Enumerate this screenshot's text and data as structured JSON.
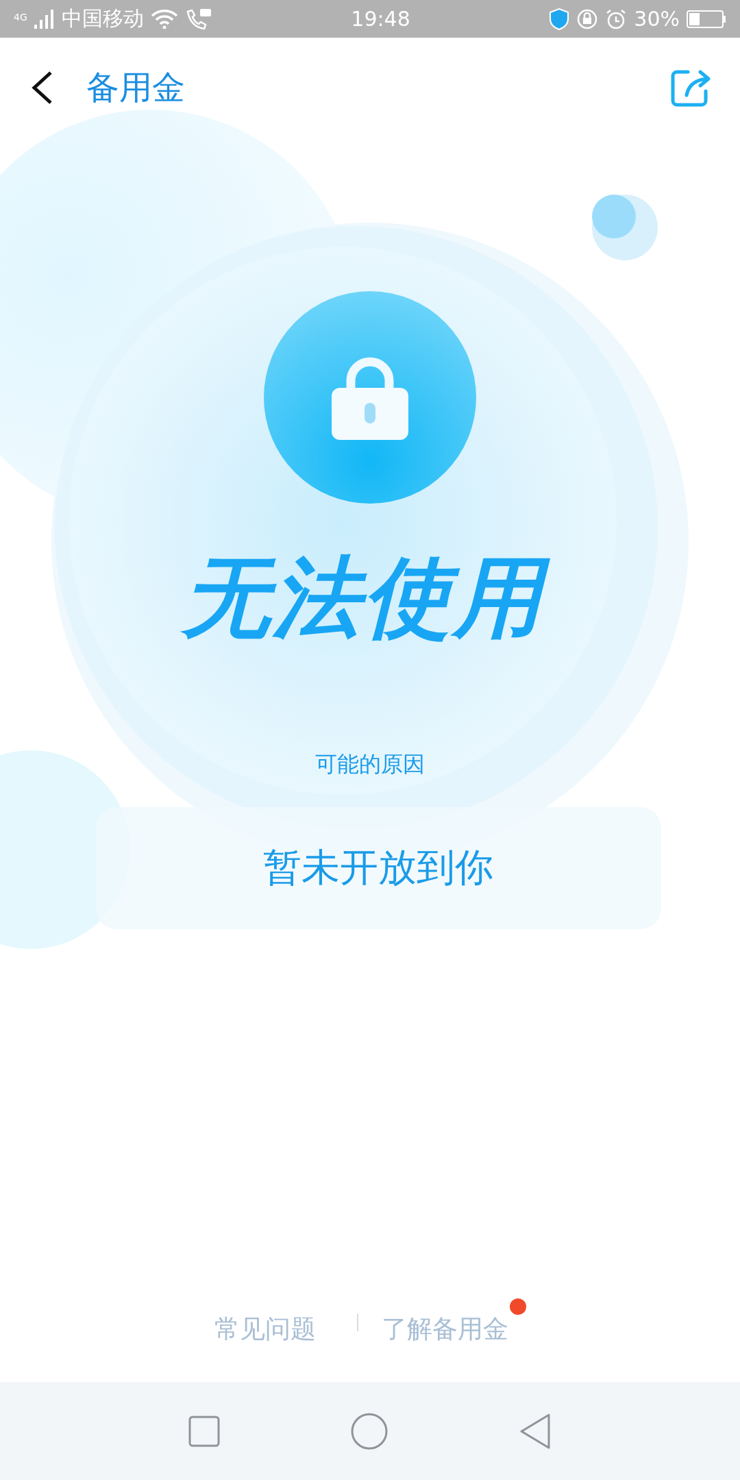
{
  "status_bar": {
    "network": "4G",
    "carrier": "中国移动",
    "time": "19:48",
    "battery": "30%"
  },
  "header": {
    "title": "备用金"
  },
  "status": {
    "headline": "无法使用",
    "reason_label": "可能的原因",
    "reason": "暂未开放到你"
  },
  "footer_links": [
    {
      "label": "常见问题",
      "dot": false
    },
    {
      "label": "了解备用金",
      "dot": true
    }
  ]
}
